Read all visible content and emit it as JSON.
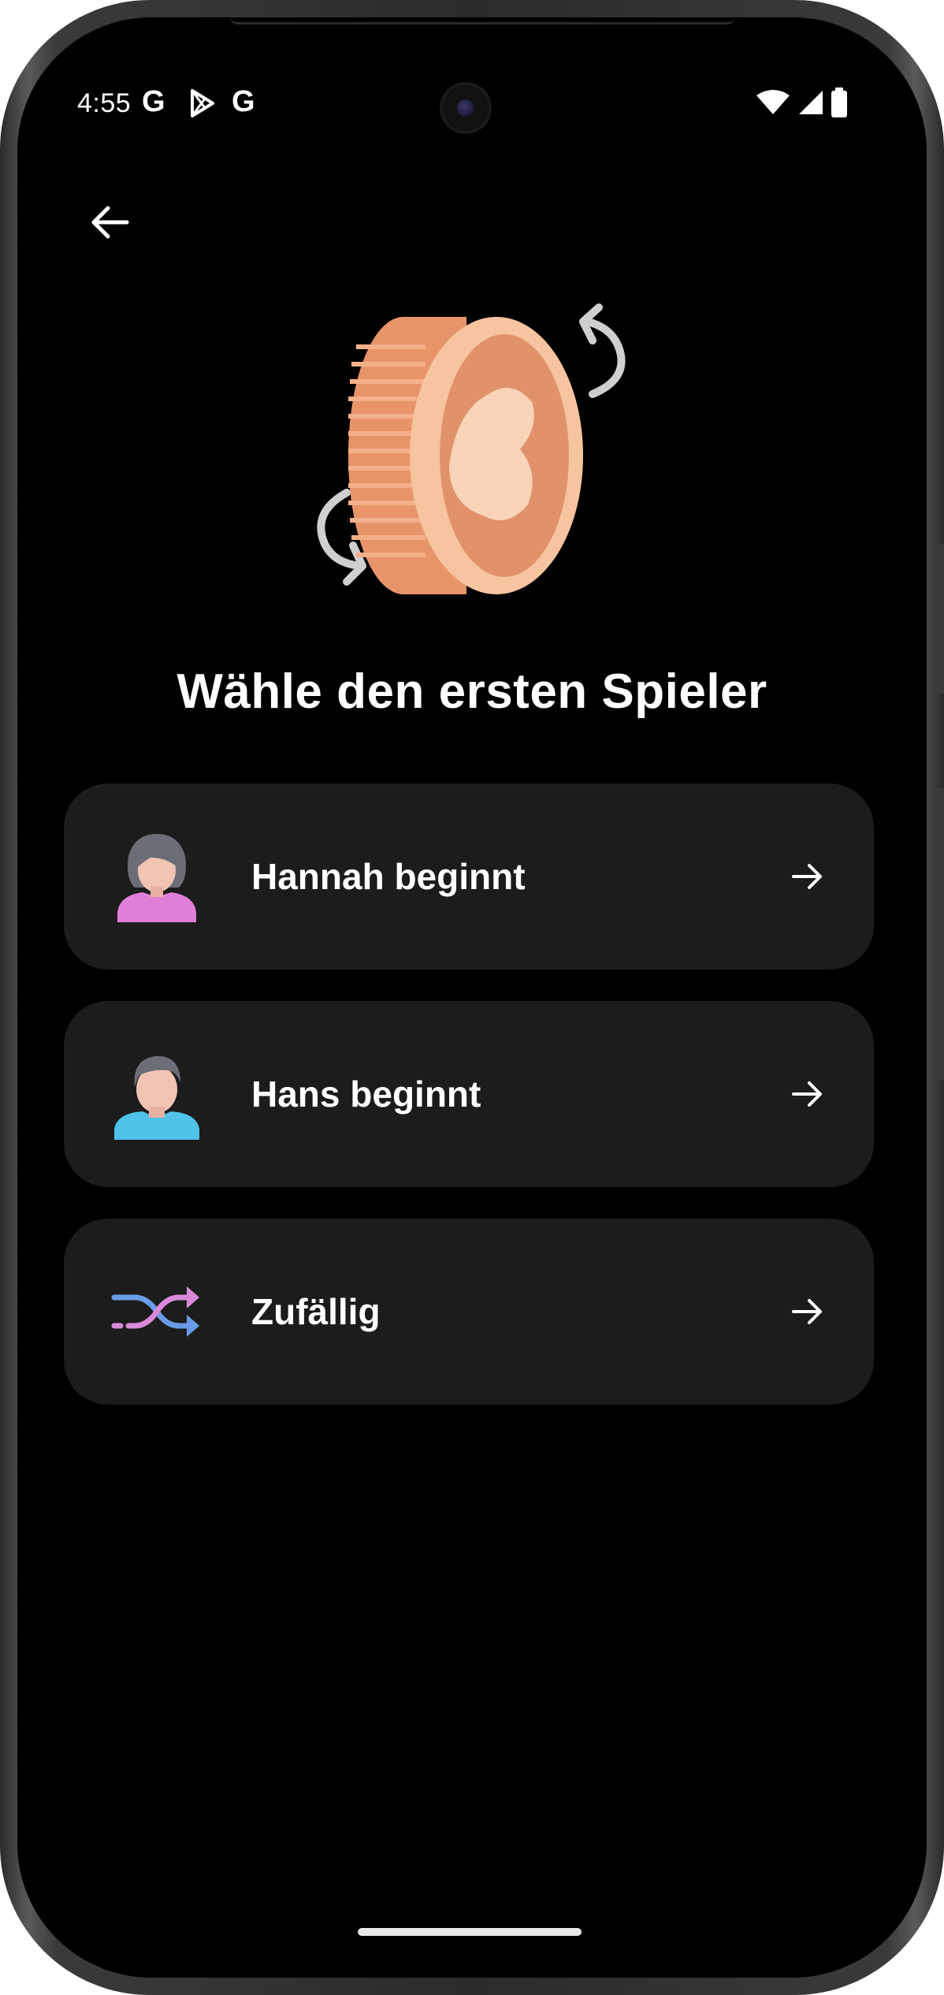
{
  "status_bar": {
    "time": "4:55",
    "left_icons": [
      "google-icon",
      "play-store-icon",
      "google-icon"
    ],
    "right_icons": [
      "wifi-icon",
      "signal-icon",
      "battery-icon"
    ],
    "google_letter": "G"
  },
  "header": {
    "back_icon": "arrow-left-icon"
  },
  "illustration": {
    "name": "coin-flip-illustration",
    "coin_color": "#e8946a",
    "coin_highlight": "#f8c4a0"
  },
  "title": "Wähle den ersten Spieler",
  "options": [
    {
      "label": "Hannah beginnt",
      "icon": "female-avatar-icon",
      "accent": "#d88ad8"
    },
    {
      "label": "Hans beginnt",
      "icon": "male-avatar-icon",
      "accent": "#4fc3ea"
    },
    {
      "label": "Zufällig",
      "icon": "shuffle-icon",
      "accent": "#6a9be6"
    }
  ],
  "colors": {
    "background": "#000000",
    "card": "#1c1c1d",
    "text": "#ffffff"
  }
}
